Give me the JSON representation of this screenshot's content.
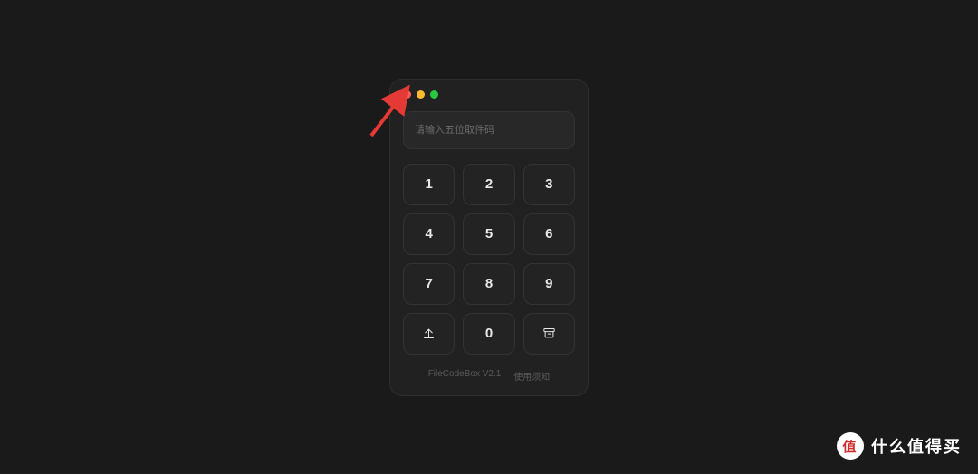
{
  "input": {
    "placeholder": "请输入五位取件码",
    "value": ""
  },
  "keypad": {
    "k1": "1",
    "k2": "2",
    "k3": "3",
    "k4": "4",
    "k5": "5",
    "k6": "6",
    "k7": "7",
    "k8": "8",
    "k9": "9",
    "k0": "0"
  },
  "footer": {
    "version": "FileCodeBox V2.1",
    "notice": "使用须知"
  },
  "watermark": {
    "badge": "值",
    "text": "什么值得买"
  }
}
